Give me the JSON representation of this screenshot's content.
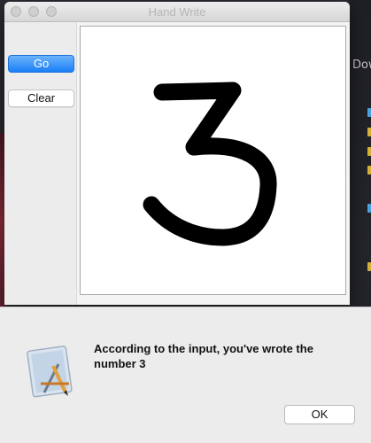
{
  "window": {
    "title": "Hand Write"
  },
  "sidebar": {
    "go_label": "Go",
    "clear_label": "Clear"
  },
  "canvas": {
    "drawn_digit": "3"
  },
  "background": {
    "partial_text": "Dow"
  },
  "alert": {
    "message": "According to the input, you've wrote the number 3",
    "ok_label": "OK",
    "icon": "app-icon"
  },
  "colors": {
    "primary_button": "#1a7ff6",
    "window_bg": "#ececec",
    "ink": "#000000"
  }
}
